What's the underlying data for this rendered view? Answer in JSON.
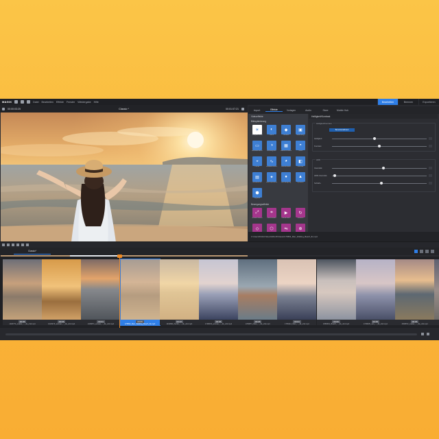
{
  "app": {
    "logo": "MAGIX",
    "menu": [
      "Datei",
      "Bearbeiten",
      "Effekte",
      "Fenster",
      "Wiedergabe",
      "Hilfe"
    ],
    "modes": [
      {
        "label": "Bearbeiten",
        "active": true
      },
      {
        "label": "Brennen",
        "active": false
      },
      {
        "label": "Exportieren",
        "active": false
      }
    ]
  },
  "preview": {
    "timecode": "00:00:03:25",
    "title": "Classic *",
    "duration": "00:01:07:21",
    "scrub_label": "00:01:04"
  },
  "media_tabs": [
    {
      "label": "Import",
      "active": false
    },
    {
      "label": "Effekte",
      "active": true
    },
    {
      "label": "Vorlagen",
      "active": false
    },
    {
      "label": "Audio",
      "active": false
    },
    {
      "label": "Store",
      "active": false
    },
    {
      "label": "Mobile Hub",
      "active": false
    }
  ],
  "effects": {
    "category": "Videoeffekte",
    "subcategory_top": "Bildoptimierung",
    "subcategory_bottom": "Bewegungseffekte",
    "items": [
      {
        "label": "Helligkeit/Kontrast",
        "icon": "sun",
        "selected": true
      },
      {
        "label": "Farbe",
        "icon": "color",
        "selected": false
      },
      {
        "label": "Schärfe",
        "icon": "sharp",
        "selected": false
      },
      {
        "label": "Belichtung",
        "icon": "exposure",
        "selected": false
      },
      {
        "label": "Bildstabilisierung",
        "icon": "frame",
        "selected": false
      },
      {
        "label": "Weißabgleich",
        "icon": "wb",
        "selected": false
      },
      {
        "label": "Rauschminderung",
        "icon": "noise",
        "selected": false
      },
      {
        "label": "Tiefen",
        "icon": "shadows",
        "selected": false
      },
      {
        "label": "Lichter",
        "icon": "highlights",
        "selected": false
      },
      {
        "label": "Gradationskurven",
        "icon": "curves",
        "selected": false
      },
      {
        "label": "Farbkorrektur",
        "icon": "colorcorr",
        "selected": false
      },
      {
        "label": "Kontrast",
        "icon": "contrast",
        "selected": false
      },
      {
        "label": "Entrauschen",
        "icon": "denoise",
        "selected": false
      },
      {
        "label": "Auto-Optimierung",
        "icon": "auto",
        "selected": false
      },
      {
        "label": "Farbsättigung",
        "icon": "drop",
        "selected": false
      },
      {
        "label": "Dynamik",
        "icon": "dyn",
        "selected": false
      },
      {
        "label": "Vignette",
        "icon": "vignette",
        "selected": false
      }
    ],
    "motion_items": [
      {
        "label": "Größe/Position",
        "icon": "resize"
      },
      {
        "label": "Zuschneiden",
        "icon": "crop"
      },
      {
        "label": "Kamerafahrt",
        "icon": "camera"
      },
      {
        "label": "Rotation",
        "icon": "rotate"
      },
      {
        "label": "3D-Verformung",
        "icon": "warp"
      },
      {
        "label": "Form",
        "icon": "shape"
      },
      {
        "label": "Spiegeln",
        "icon": "mirror"
      },
      {
        "label": "Zoom",
        "icon": "zoom"
      }
    ]
  },
  "properties": {
    "title": "Helligkeit/Kontrast",
    "group1_label": "Helligkeit/Kontrast",
    "preset_label": "Benutzerdefiniert",
    "rows1": [
      {
        "label": "Helligkeit",
        "value": 0.45
      },
      {
        "label": "Kontrast",
        "value": 0.5
      }
    ],
    "group2_label": "HDR",
    "rows2": [
      {
        "label": "Intensität",
        "value": 0.54
      },
      {
        "label": "HDR-Intensität",
        "value": 0.03
      },
      {
        "label": "Schärfe",
        "value": 0.52
      }
    ],
    "footer_path": "C:\\Users\\Public\\Videos\\MAGIX\\Classic\\175893_Man_Walking_Beach_8s.mp4"
  },
  "timeline": {
    "sequence_tab": "Classic*",
    "clips": [
      {
        "duration": "00:05",
        "filename": "1023774_matter_..._4k_uhd.mp4",
        "scene": "beach-dusk",
        "selected": false
      },
      {
        "duration": "00:06",
        "filename": "1023476_woman_..._4k_uhd.mp4",
        "scene": "silhouette",
        "selected": false
      },
      {
        "duration": "00:04",
        "filename": "1346871_sunset_..._4k_uhd.mp4",
        "scene": "sea-sunset",
        "selected": false
      },
      {
        "duration": "00:05",
        "filename": "175893_Man_Walking_Beach_8s.mp4",
        "scene": "rocks-sea",
        "selected": true
      },
      {
        "duration": "00:07",
        "filename": "1332890_Surfer_..._4k_uhd.mp4",
        "scene": "surfer",
        "selected": false
      },
      {
        "duration": "00:05",
        "filename": "1748033_woman_..._4k_uhd.mp4",
        "scene": "van",
        "selected": false
      },
      {
        "duration": "00:05",
        "filename": "1783871_Man_..._4k_uhd.mp4",
        "scene": "portrait",
        "selected": false
      },
      {
        "duration": "00:04",
        "filename": "1765112_Man_..._4k_uhd.mp4",
        "scene": "van-roof",
        "selected": false
      },
      {
        "duration": "00:06",
        "filename": "1868361_Beach_..._4k_uhd.mp4",
        "scene": "hazy-sea",
        "selected": false
      },
      {
        "duration": "00:05",
        "filename": "1748035_van_..._4k_uhd.mp4",
        "scene": "van2",
        "selected": false
      },
      {
        "duration": "00:06",
        "filename": "1846872_matter_..._4k_uhd.mp4",
        "scene": "sunset-beach",
        "selected": false
      },
      {
        "duration": "00:03",
        "filename": "1023773_..._4k.mp4",
        "scene": "partial",
        "selected": false
      }
    ]
  },
  "colors": {
    "accent": "#2f7fe8",
    "playhead": "#f08a24",
    "motion": "#a4368c"
  }
}
